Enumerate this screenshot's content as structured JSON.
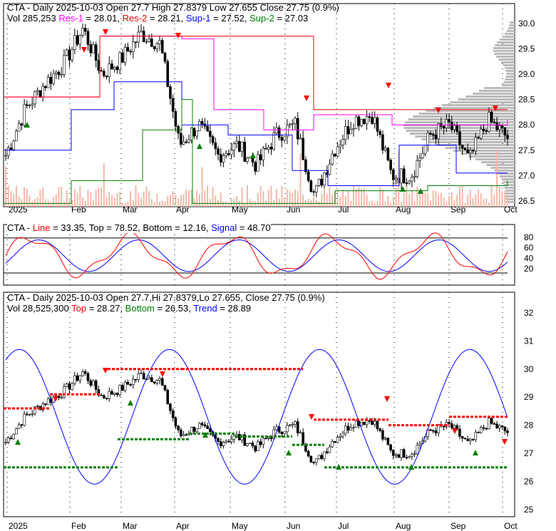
{
  "panel1": {
    "line1": "CTA - Daily 2025-10-03 Open 27.7  High 27.8379  Low 27.655  Close 27.75 (0.9%)",
    "vol": "Vol 285,253",
    "res1": "Res-1",
    "res1_val": " = 28.01, ",
    "res2": "Res-2",
    "res2_val": " = 28.21, ",
    "sup1": "Sup-1",
    "sup1_val": " = 27.52, ",
    "sup2": "Sup-2",
    "sup2_val": " = 27.03"
  },
  "panel2": {
    "prefix": "CTA - ",
    "line": "Line",
    "line_val": " = 33.35, Top = 78.52, Bottom = 12.16, ",
    "signal": "Signal",
    "signal_val": " = 48.70"
  },
  "panel3": {
    "line1": "CTA - Daily 2025-10-03 Open 27.7,Hi 27.8379,Lo 27.655, Close 27.75 (0.9%)",
    "vol": "Vol 28,525,300 ",
    "top": "Top",
    "top_val": " = 28.27, ",
    "bottom": "Bottom",
    "bottom_val": " = 26.53, ",
    "trend": "Trend",
    "trend_val": " = 28.89"
  },
  "colors": {
    "res1": "#ff00ff",
    "res2": "#ff0000",
    "sup1": "#0000ff",
    "sup2": "#008000",
    "up": "#008000",
    "down": "#ff0000"
  },
  "chart_data": {
    "type": "line",
    "months": [
      "2025",
      "Feb",
      "Mar",
      "Apr",
      "May",
      "Jun",
      "Jul",
      "Aug",
      "Sep",
      "Oct"
    ],
    "price_ticks_top": [
      "30.0",
      "29.5",
      "29.0",
      "28.5",
      "28.0",
      "27.5",
      "27.0",
      "26.5"
    ],
    "osc_ticks": [
      "80",
      "60",
      "40",
      "20"
    ],
    "price_ticks_bottom": [
      "32",
      "31",
      "30",
      "29",
      "28",
      "27",
      "26",
      "25"
    ],
    "close_approx": [
      27.4,
      28.3,
      28.8,
      29.2,
      29.9,
      29.0,
      29.3,
      29.8,
      29.6,
      27.6,
      28.0,
      27.4,
      27.6,
      27.2,
      27.8,
      28.0,
      26.6,
      27.5,
      28.1,
      28.2,
      27.0,
      27.0,
      27.8,
      28.0,
      27.3,
      28.1,
      27.75
    ],
    "oscillator": {
      "line": 33.35,
      "top": 78.52,
      "bottom": 12.16,
      "signal": 48.7
    },
    "levels": {
      "res1": 28.01,
      "res2": 28.21,
      "sup1": 27.52,
      "sup2": 27.03,
      "top": 28.27,
      "bottom": 26.53,
      "trend": 28.89
    }
  }
}
